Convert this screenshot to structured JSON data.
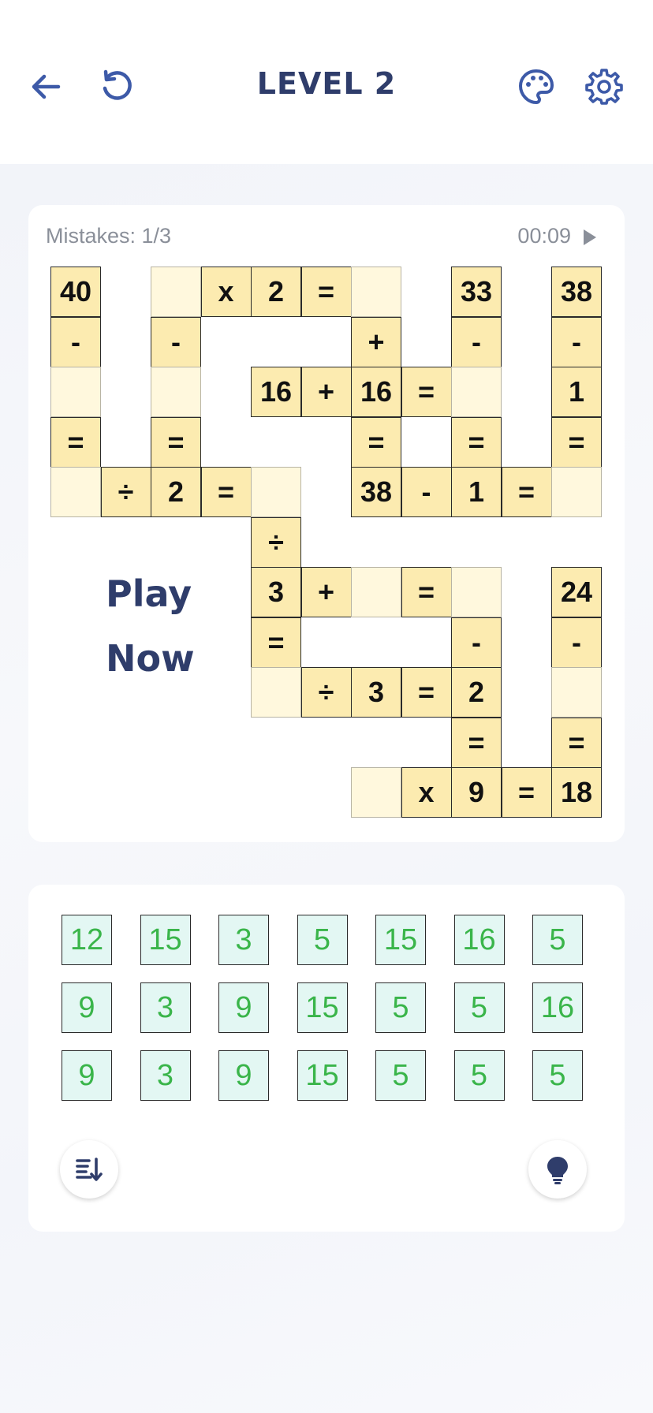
{
  "header": {
    "title": "LEVEL 2",
    "back_icon": "arrow-left-icon",
    "restart_icon": "restart-icon",
    "theme_icon": "palette-icon",
    "settings_icon": "gear-icon",
    "accent_color": "#3d5aa8"
  },
  "status": {
    "mistakes": "Mistakes: 1/3",
    "timer": "00:09",
    "pause_icon": "play-icon"
  },
  "board": {
    "cell_colors": {
      "filled": "#fcebb0",
      "empty": "#fff8dd"
    },
    "cells": [
      {
        "r": 0,
        "c": 0,
        "v": "40"
      },
      {
        "r": 0,
        "c": 2,
        "v": ""
      },
      {
        "r": 0,
        "c": 3,
        "v": "x"
      },
      {
        "r": 0,
        "c": 4,
        "v": "2"
      },
      {
        "r": 0,
        "c": 5,
        "v": "="
      },
      {
        "r": 0,
        "c": 6,
        "v": ""
      },
      {
        "r": 0,
        "c": 8,
        "v": "33"
      },
      {
        "r": 0,
        "c": 10,
        "v": "38"
      },
      {
        "r": 1,
        "c": 0,
        "v": "-"
      },
      {
        "r": 1,
        "c": 2,
        "v": "-"
      },
      {
        "r": 1,
        "c": 6,
        "v": "+"
      },
      {
        "r": 1,
        "c": 8,
        "v": "-"
      },
      {
        "r": 1,
        "c": 10,
        "v": "-"
      },
      {
        "r": 2,
        "c": 0,
        "v": ""
      },
      {
        "r": 2,
        "c": 2,
        "v": ""
      },
      {
        "r": 2,
        "c": 4,
        "v": "16"
      },
      {
        "r": 2,
        "c": 5,
        "v": "+"
      },
      {
        "r": 2,
        "c": 6,
        "v": "16"
      },
      {
        "r": 2,
        "c": 7,
        "v": "="
      },
      {
        "r": 2,
        "c": 8,
        "v": ""
      },
      {
        "r": 2,
        "c": 10,
        "v": "1"
      },
      {
        "r": 3,
        "c": 0,
        "v": "="
      },
      {
        "r": 3,
        "c": 2,
        "v": "="
      },
      {
        "r": 3,
        "c": 6,
        "v": "="
      },
      {
        "r": 3,
        "c": 8,
        "v": "="
      },
      {
        "r": 3,
        "c": 10,
        "v": "="
      },
      {
        "r": 4,
        "c": 0,
        "v": ""
      },
      {
        "r": 4,
        "c": 1,
        "v": "÷"
      },
      {
        "r": 4,
        "c": 2,
        "v": "2"
      },
      {
        "r": 4,
        "c": 3,
        "v": "="
      },
      {
        "r": 4,
        "c": 4,
        "v": ""
      },
      {
        "r": 4,
        "c": 6,
        "v": "38"
      },
      {
        "r": 4,
        "c": 7,
        "v": "-"
      },
      {
        "r": 4,
        "c": 8,
        "v": "1"
      },
      {
        "r": 4,
        "c": 9,
        "v": "="
      },
      {
        "r": 4,
        "c": 10,
        "v": ""
      },
      {
        "r": 5,
        "c": 4,
        "v": "÷"
      },
      {
        "r": 6,
        "c": 4,
        "v": "3"
      },
      {
        "r": 6,
        "c": 5,
        "v": "+"
      },
      {
        "r": 6,
        "c": 6,
        "v": ""
      },
      {
        "r": 6,
        "c": 7,
        "v": "="
      },
      {
        "r": 6,
        "c": 8,
        "v": ""
      },
      {
        "r": 6,
        "c": 10,
        "v": "24"
      },
      {
        "r": 7,
        "c": 4,
        "v": "="
      },
      {
        "r": 7,
        "c": 8,
        "v": "-"
      },
      {
        "r": 7,
        "c": 10,
        "v": "-"
      },
      {
        "r": 8,
        "c": 4,
        "v": ""
      },
      {
        "r": 8,
        "c": 5,
        "v": "÷"
      },
      {
        "r": 8,
        "c": 6,
        "v": "3"
      },
      {
        "r": 8,
        "c": 7,
        "v": "="
      },
      {
        "r": 8,
        "c": 8,
        "v": "2"
      },
      {
        "r": 8,
        "c": 10,
        "v": ""
      },
      {
        "r": 9,
        "c": 8,
        "v": "="
      },
      {
        "r": 9,
        "c": 10,
        "v": "="
      },
      {
        "r": 10,
        "c": 6,
        "v": ""
      },
      {
        "r": 10,
        "c": 7,
        "v": "x"
      },
      {
        "r": 10,
        "c": 8,
        "v": "9"
      },
      {
        "r": 10,
        "c": 9,
        "v": "="
      },
      {
        "r": 10,
        "c": 10,
        "v": "18"
      }
    ],
    "promo_line1": "Play",
    "promo_line2": "Now"
  },
  "tiles": {
    "tile_color": "#e3f7f3",
    "number_color": "#3ab54a",
    "rows": [
      [
        "12",
        "15",
        "3",
        "5",
        "15",
        "16",
        "5"
      ],
      [
        "9",
        "3",
        "9",
        "15",
        "5",
        "5",
        "16"
      ],
      [
        "9",
        "3",
        "9",
        "15",
        "5",
        "5",
        "5"
      ]
    ]
  },
  "actions": {
    "sort_icon": "sort-descending-icon",
    "hint_icon": "lightbulb-icon"
  }
}
